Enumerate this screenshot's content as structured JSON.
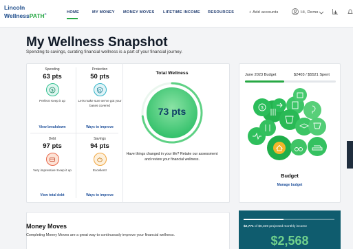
{
  "logo": {
    "line1": "Lincoln",
    "line2a": "Wellness",
    "line2b": "PATH",
    "tm": "®"
  },
  "nav": {
    "home": "HOME",
    "my_money": "MY MONEY",
    "money_moves": "MONEY MOVES",
    "lifetime_income": "LIFETIME INCOME",
    "resources": "RESOURCES",
    "add_accounts": "+  Add accounts",
    "user": "Hi, Demo"
  },
  "page": {
    "title": "My Wellness Snapshot",
    "subtitle": "Spending to savings, curating financial wellness is a part of your financial journey."
  },
  "tiles": [
    {
      "label": "Spending",
      "pts": "63 pts",
      "message": "Perfect! Keep it up",
      "link": "View breakdown",
      "icon": "dollar-icon",
      "fill": "#def6ef",
      "ring": "#2fbf8f"
    },
    {
      "label": "Protection",
      "pts": "50 pts",
      "message": "Let's make sure we've got your bases covered",
      "link": "Ways to improve",
      "icon": "shield-icon",
      "fill": "#dff3f7",
      "ring": "#33b4c7"
    },
    {
      "label": "Debt",
      "pts": "97 pts",
      "message": "Very impressive! Keep it up",
      "link": "View total debt",
      "icon": "credit-card-icon",
      "fill": "#fde3d6",
      "ring": "#e8674a"
    },
    {
      "label": "Savings",
      "pts": "94 pts",
      "message": "Excellent!",
      "link": "Ways to improve",
      "icon": "piggy-bank-icon",
      "fill": "#fdf0dc",
      "ring": "#f0a43c"
    }
  ],
  "total_wellness": {
    "title": "Total Wellness",
    "points": "73 pts",
    "score": 73,
    "message": "Have things changed in your life? Retake our assessment and review your financial wellness."
  },
  "budget": {
    "month_label": "June 2023 Budget",
    "spent_label": "$2403 / $5521 Spent",
    "progress": 0.435,
    "title": "Budget",
    "link": "Manage budget"
  },
  "money_moves": {
    "title": "Money Moves",
    "text": "Completing Money Moves are a great way to continuously improve your financial wellness."
  },
  "income": {
    "caption_amount": "$2,771",
    "caption_rest": "of $6,339 projected monthly income",
    "amount": "$2,568",
    "progress": 0.437
  },
  "colors": {
    "accent": "#27a844",
    "navy": "#0f3f66",
    "teal": "#0f5c6e"
  }
}
